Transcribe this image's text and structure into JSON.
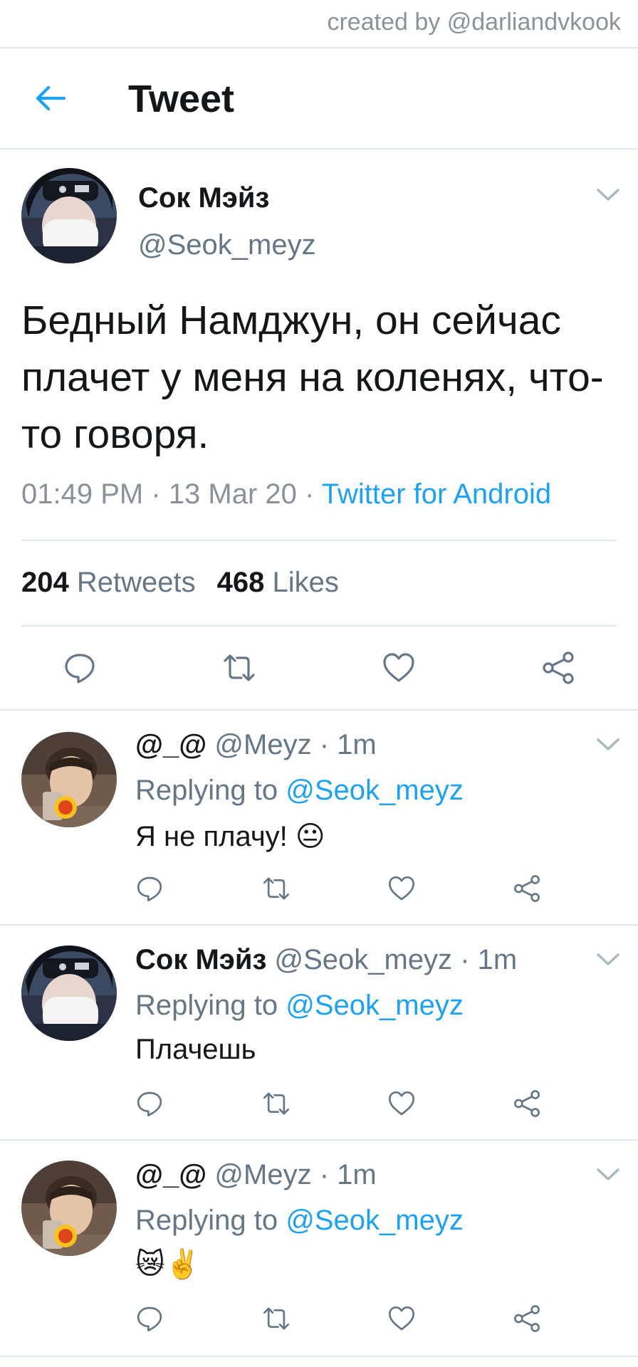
{
  "credit": "created by @darliandvkook",
  "header": {
    "title": "Tweet"
  },
  "main_tweet": {
    "name": "Сок Мэйз",
    "handle": "@Seok_meyz",
    "text": "Бедный Намджун, он сейчас плачет у меня на коленях, что-то говоря.",
    "time": "01:49 PM",
    "date": "13 Mar 20",
    "source": "Twitter for Android",
    "retweets_count": "204",
    "retweets_label": "Retweets",
    "likes_count": "468",
    "likes_label": "Likes"
  },
  "replies": [
    {
      "name": "@_@",
      "handle": "@Meyz",
      "time": "1m",
      "replying_label": "Replying to",
      "replying_to": "@Seok_meyz",
      "text": "Я не плачу! 😐"
    },
    {
      "name": "Сок Мэйз",
      "handle": "@Seok_meyz",
      "time": "1m",
      "replying_label": "Replying to",
      "replying_to": "@Seok_meyz",
      "text": "Плачешь"
    },
    {
      "name": "@_@",
      "handle": "@Meyz",
      "time": "1m",
      "replying_label": "Replying to",
      "replying_to": "@Seok_meyz",
      "text": "😿✌️"
    }
  ],
  "icons": {
    "back": "arrow-left-icon",
    "reply": "reply-icon",
    "retweet": "retweet-icon",
    "like": "heart-icon",
    "share": "share-icon",
    "more": "chevron-down-icon"
  },
  "colors": {
    "accent": "#1da1f2",
    "text": "#14171a",
    "secondary": "#657786",
    "divider": "#e1e8ed"
  }
}
